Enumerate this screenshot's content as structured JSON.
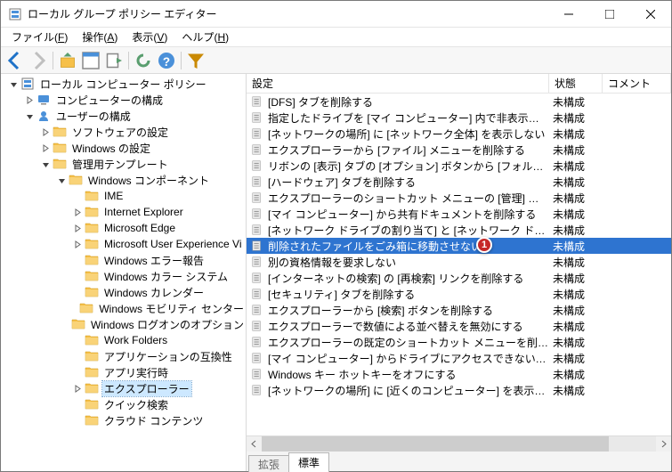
{
  "window": {
    "title": "ローカル グループ ポリシー エディター"
  },
  "menu": {
    "file": {
      "label": "ファイル",
      "accel": "F"
    },
    "action": {
      "label": "操作",
      "accel": "A"
    },
    "view": {
      "label": "表示",
      "accel": "V"
    },
    "help": {
      "label": "ヘルプ",
      "accel": "H"
    }
  },
  "tree": [
    {
      "level": 0,
      "exp": "open",
      "kind": "root",
      "label": "ローカル コンピューター ポリシー",
      "sel": false
    },
    {
      "level": 1,
      "exp": "closed",
      "kind": "comp",
      "label": "コンピューターの構成",
      "sel": false
    },
    {
      "level": 1,
      "exp": "open",
      "kind": "user",
      "label": "ユーザーの構成",
      "sel": false
    },
    {
      "level": 2,
      "exp": "closed",
      "kind": "folder",
      "label": "ソフトウェアの設定",
      "sel": false
    },
    {
      "level": 2,
      "exp": "closed",
      "kind": "folder",
      "label": "Windows の設定",
      "sel": false
    },
    {
      "level": 2,
      "exp": "open",
      "kind": "folder",
      "label": "管理用テンプレート",
      "sel": false
    },
    {
      "level": 3,
      "exp": "open",
      "kind": "folder",
      "label": "Windows コンポーネント",
      "sel": false
    },
    {
      "level": 4,
      "exp": "leaf",
      "kind": "folder",
      "label": "IME",
      "sel": false
    },
    {
      "level": 4,
      "exp": "closed",
      "kind": "folder",
      "label": "Internet Explorer",
      "sel": false
    },
    {
      "level": 4,
      "exp": "closed",
      "kind": "folder",
      "label": "Microsoft Edge",
      "sel": false
    },
    {
      "level": 4,
      "exp": "closed",
      "kind": "folder",
      "label": "Microsoft User Experience Vi",
      "sel": false
    },
    {
      "level": 4,
      "exp": "leaf",
      "kind": "folder",
      "label": "Windows エラー報告",
      "sel": false
    },
    {
      "level": 4,
      "exp": "leaf",
      "kind": "folder",
      "label": "Windows カラー システム",
      "sel": false
    },
    {
      "level": 4,
      "exp": "leaf",
      "kind": "folder",
      "label": "Windows カレンダー",
      "sel": false
    },
    {
      "level": 4,
      "exp": "leaf",
      "kind": "folder",
      "label": "Windows モビリティ センター",
      "sel": false
    },
    {
      "level": 4,
      "exp": "leaf",
      "kind": "folder",
      "label": "Windows ログオンのオプション",
      "sel": false
    },
    {
      "level": 4,
      "exp": "leaf",
      "kind": "folder",
      "label": "Work Folders",
      "sel": false
    },
    {
      "level": 4,
      "exp": "leaf",
      "kind": "folder",
      "label": "アプリケーションの互換性",
      "sel": false
    },
    {
      "level": 4,
      "exp": "leaf",
      "kind": "folder",
      "label": "アプリ実行時",
      "sel": false
    },
    {
      "level": 4,
      "exp": "closed",
      "kind": "folder",
      "label": "エクスプローラー",
      "sel": true
    },
    {
      "level": 4,
      "exp": "leaf",
      "kind": "folder",
      "label": "クイック検索",
      "sel": false
    },
    {
      "level": 4,
      "exp": "leaf",
      "kind": "folder",
      "label": "クラウド コンテンツ",
      "sel": false
    }
  ],
  "list": {
    "head": {
      "name": "設定",
      "state": "状態",
      "comment": "コメント"
    },
    "items": [
      {
        "name": "[DFS] タブを削除する",
        "state": "未構成",
        "sel": false
      },
      {
        "name": "指定したドライブを [マイ コンピューター] 内で非表示にする",
        "state": "未構成",
        "sel": false
      },
      {
        "name": "[ネットワークの場所] に [ネットワーク全体] を表示しない",
        "state": "未構成",
        "sel": false
      },
      {
        "name": "エクスプローラーから [ファイル] メニューを削除する",
        "state": "未構成",
        "sel": false
      },
      {
        "name": "リボンの [表示] タブの [オプション] ボタンから [フォルダー オプショ...",
        "state": "未構成",
        "sel": false
      },
      {
        "name": "[ハードウェア] タブを削除する",
        "state": "未構成",
        "sel": false
      },
      {
        "name": "エクスプローラーのショートカット メニューの [管理] 項目を非表示に",
        "state": "未構成",
        "sel": false
      },
      {
        "name": "[マイ コンピューター] から共有ドキュメントを削除する",
        "state": "未構成",
        "sel": false
      },
      {
        "name": "[ネットワーク ドライブの割り当て] と [ネットワーク ドライブの切断] ...",
        "state": "未構成",
        "sel": false
      },
      {
        "name": "削除されたファイルをごみ箱に移動させない",
        "state": "未構成",
        "sel": true,
        "callout": "1"
      },
      {
        "name": "別の資格情報を要求しない",
        "state": "未構成",
        "sel": false
      },
      {
        "name": "[インターネットの検索] の [再検索] リンクを削除する",
        "state": "未構成",
        "sel": false
      },
      {
        "name": "[セキュリティ] タブを削除する",
        "state": "未構成",
        "sel": false
      },
      {
        "name": "エクスプローラーから [検索] ボタンを削除する",
        "state": "未構成",
        "sel": false
      },
      {
        "name": "エクスプローラーで数値による並べ替えを無効にする",
        "state": "未構成",
        "sel": false
      },
      {
        "name": "エクスプローラーの既定のショートカット メニューを削除する",
        "state": "未構成",
        "sel": false
      },
      {
        "name": "[マイ コンピューター] からドライブにアクセスできないようにする",
        "state": "未構成",
        "sel": false
      },
      {
        "name": "Windows キー ホットキーをオフにする",
        "state": "未構成",
        "sel": false
      },
      {
        "name": "[ネットワークの場所] に [近くのコンピューター] を表示しない",
        "state": "未構成",
        "sel": false
      }
    ]
  },
  "tabs": {
    "extended": "拡張",
    "standard": "標準"
  }
}
